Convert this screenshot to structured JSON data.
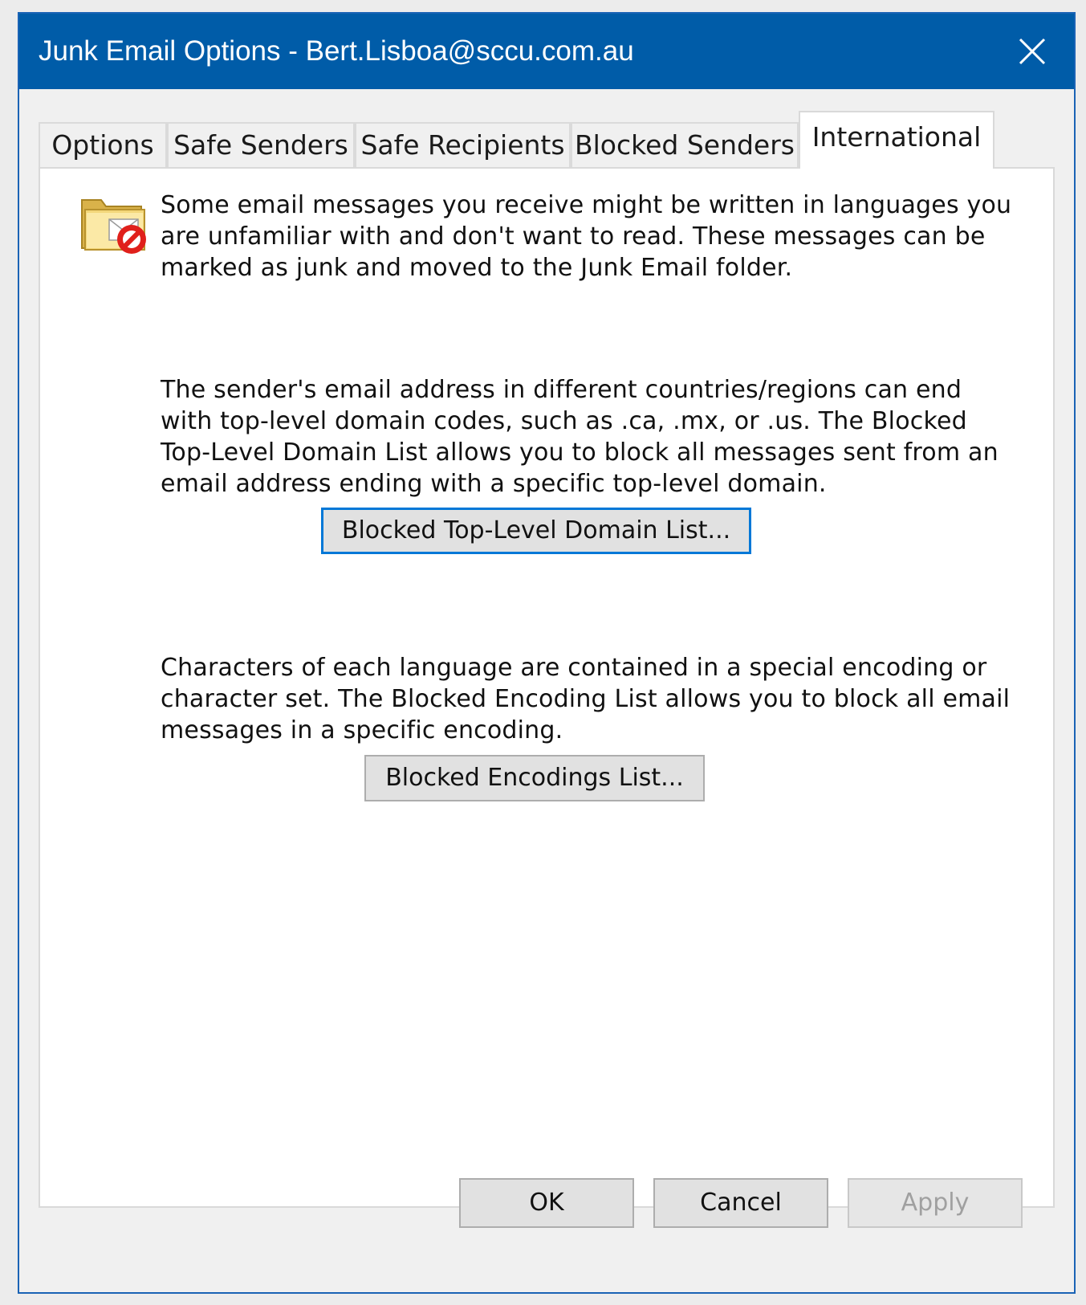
{
  "window": {
    "title": "Junk Email Options - Bert.Lisboa@sccu.com.au",
    "close_icon": "close-icon"
  },
  "tabs": [
    {
      "label": "Options",
      "active": false
    },
    {
      "label": "Safe Senders",
      "active": false
    },
    {
      "label": "Safe Recipients",
      "active": false
    },
    {
      "label": "Blocked Senders",
      "active": false
    },
    {
      "label": "International",
      "active": true
    }
  ],
  "international": {
    "icon": "junk-folder-blocked-icon",
    "intro_text": "Some email messages you receive might be written in languages you are unfamiliar with and don't want to read. These messages can be marked as junk and moved to the Junk Email folder.",
    "domain_text": "The sender's email address in different countries/regions can end with top-level domain codes, such as .ca, .mx, or .us. The Blocked Top-Level Domain List allows you to block all messages sent from an email address ending with a specific top-level domain.",
    "domain_button": "Blocked Top-Level Domain List...",
    "encoding_text": "Characters of each language are contained in a special encoding or character set. The Blocked Encoding List allows you to block all email messages in a specific encoding.",
    "encoding_button": "Blocked Encodings List..."
  },
  "footer": {
    "ok_label": "OK",
    "cancel_label": "Cancel",
    "apply_label": "Apply",
    "apply_enabled": false
  },
  "colors": {
    "titlebar": "#005ca8",
    "focus_border": "#0078d7",
    "no_symbol": "#e0201b"
  }
}
